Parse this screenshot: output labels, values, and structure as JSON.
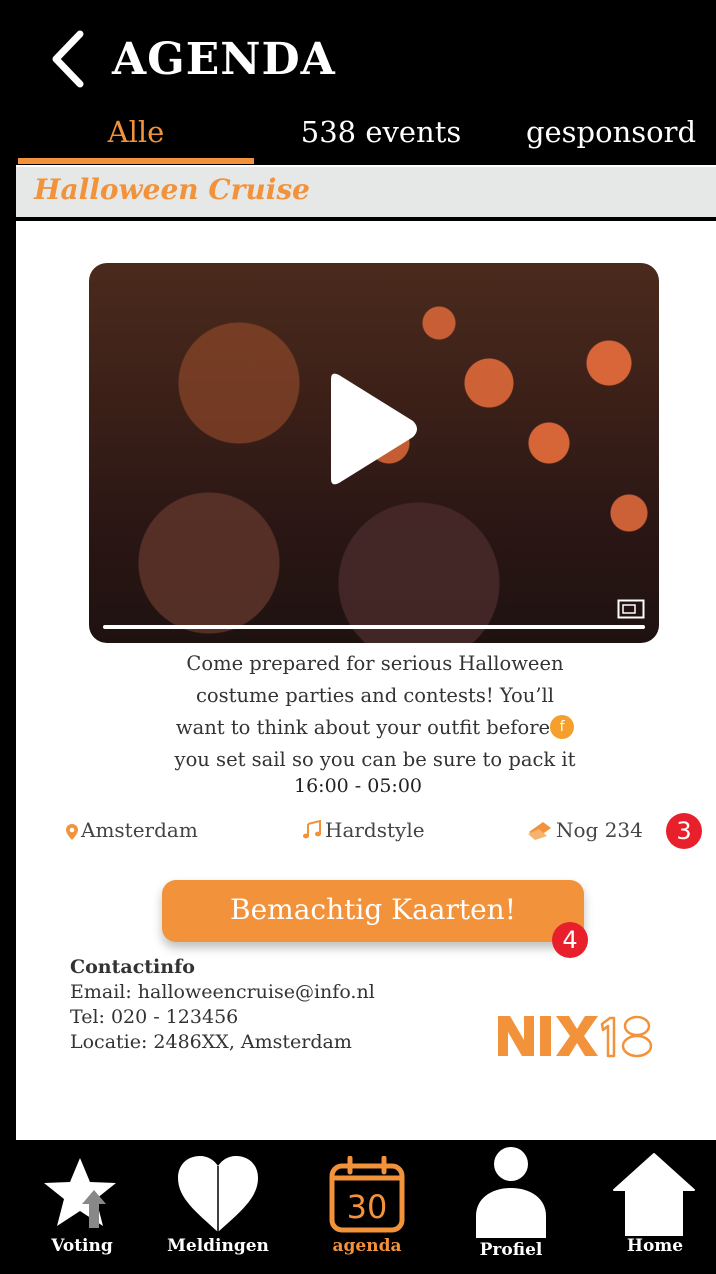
{
  "header": {
    "title": "AGENDA",
    "tabs": [
      {
        "label": "Alle",
        "active": true
      },
      {
        "label": "538 events",
        "active": false
      },
      {
        "label": "gesponsord",
        "active": false
      }
    ]
  },
  "event": {
    "title": "Halloween Cruise",
    "video": {
      "progress": 0.0
    },
    "description_lines": [
      "Come prepared for serious Halloween",
      "costume parties and contests! You’ll",
      "want to think about your outfit before",
      "you set sail so you can be sure to pack it"
    ],
    "facebook_badge": "f",
    "time": "16:00 - 05:00",
    "location": "Amsterdam",
    "genre": "Hardstyle",
    "tickets_left": "Nog 234",
    "cta_label": "Bemachtig Kaarten!"
  },
  "annotations": {
    "badge_3": "3",
    "badge_4": "4"
  },
  "contact": {
    "heading": "Contactinfo",
    "email": "Email: halloweencruise@info.nl",
    "tel": "Tel: 020 - 123456",
    "location": "Locatie: 2486XX, Amsterdam"
  },
  "logo": {
    "text": "NIX18"
  },
  "bottom_nav": [
    {
      "label": "Voting",
      "icon": "star-upload-icon",
      "active": false
    },
    {
      "label": "Meldingen",
      "icon": "heart-icon",
      "active": false
    },
    {
      "label": "agenda",
      "icon": "calendar-icon",
      "active": true,
      "calendar_day": "30"
    },
    {
      "label": "Profiel",
      "icon": "person-icon",
      "active": false
    },
    {
      "label": "Home",
      "icon": "home-icon",
      "active": false
    }
  ],
  "colors": {
    "accent": "#f2923a",
    "badge": "#e8202c",
    "header_bg": "#000000",
    "bar_bg": "#e6e8e8"
  }
}
